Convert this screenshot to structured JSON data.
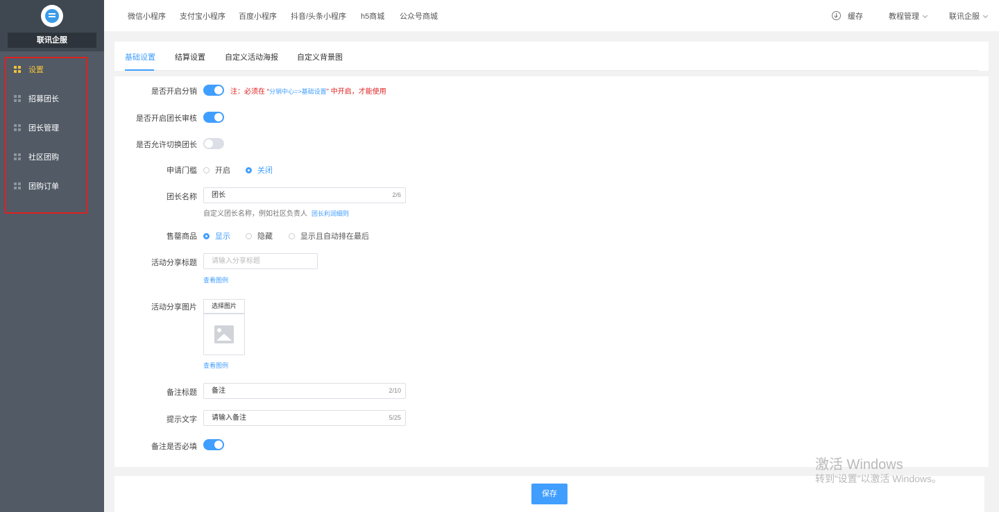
{
  "sidebar": {
    "brand_name": "联讯企服",
    "items": [
      {
        "label": "设置"
      },
      {
        "label": "招募团长"
      },
      {
        "label": "团长管理"
      },
      {
        "label": "社区团购"
      },
      {
        "label": "团购订单"
      }
    ]
  },
  "topnav": {
    "items": [
      "微信小程序",
      "支付宝小程序",
      "百度小程序",
      "抖音/头条小程序",
      "h5商城",
      "公众号商城"
    ],
    "cache": "缓存",
    "tutorial": "教程管理",
    "account": "联讯企服"
  },
  "tabs": [
    "基础设置",
    "结算设置",
    "自定义活动海报",
    "自定义背景图"
  ],
  "form": {
    "enable_distribution": {
      "label": "是否开启分销",
      "note_prefix": "注：必须在 “",
      "note_link": "分销中心=>基础设置",
      "note_suffix": "” 中开启，才能使用"
    },
    "enable_leader_review": {
      "label": "是否开启团长审核"
    },
    "allow_switch_leader": {
      "label": "是否允许切换团长"
    },
    "apply_threshold": {
      "label": "申请门槛",
      "options": [
        "开启",
        "关闭"
      ]
    },
    "leader_name": {
      "label": "团长名称",
      "value": "团长",
      "counter": "2/6",
      "hint": "自定义团长名称，例如社区负责人",
      "hint_link": "团长利润细则"
    },
    "sold_out_goods": {
      "label": "售罄商品",
      "options": [
        "显示",
        "隐藏",
        "显示且自动排在最后"
      ]
    },
    "share_title": {
      "label": "活动分享标题",
      "placeholder": "请输入分享标题",
      "example_link": "查看图例"
    },
    "share_image": {
      "label": "活动分享图片",
      "button": "选择图片",
      "example_link": "查看图例"
    },
    "remark_title": {
      "label": "备注标题",
      "value": "备注",
      "counter": "2/10"
    },
    "tip_text": {
      "label": "提示文字",
      "value": "请输入备注",
      "counter": "5/25"
    },
    "remark_required": {
      "label": "备注是否必填"
    }
  },
  "footer": {
    "save": "保存"
  },
  "watermark": {
    "line1": "激活 Windows",
    "line2": "转到“设置”以激活 Windows。"
  }
}
